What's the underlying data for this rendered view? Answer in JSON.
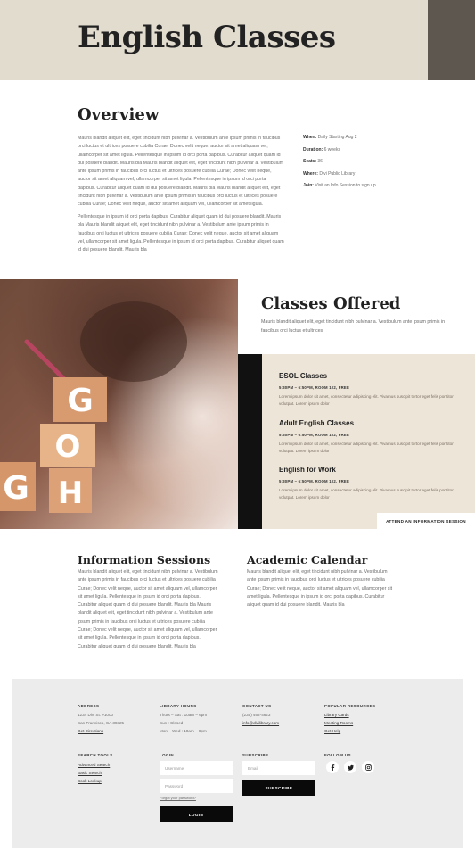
{
  "hero": {
    "title": "English Classes"
  },
  "overview": {
    "title": "Overview",
    "p1": "Mauris blandit aliquet elit, eget tincidunt nibh pulvinar a. Vestibulum ante ipsum primis in faucibus orci luctus et ultrices posuere cubilia Curae; Donec velit neque, auctor sit amet aliquam vel, ullamcorper sit amet ligula. Pellentesque in ipsum id orci porta dapibus. Curabitur aliquet quam id dui posuere blandit. Mauris bla Mauris blandit aliquet elit, eget tincidunt nibh pulvinar a. Vestibulum ante ipsum primis in faucibus orci luctus et ultrices posuere cubilia Curae; Donec velit neque, auctor sit amet aliquam vel, ullamcorper sit amet ligula. Pellentesque in ipsum id orci porta dapibus. Curabitur aliquet quam id dui posuere blandit. Mauris bla Mauris blandit aliquet elit, eget tincidunt nibh pulvinar a. Vestibulum ante ipsum primis in faucibus orci luctus et ultrices posuere cubilia Curae; Donec velit neque, auctor sit amet aliquam vel, ullamcorper sit amet ligula.",
    "p2": "Pellentesque in ipsum id orci porta dapibus. Curabitur aliquet quam id dui posuere blandit. Mauris bla Mauris blandit aliquet elit, eget tincidunt nibh pulvinar a. Vestibulum ante ipsum primis in faucibus orci luctus et ultrices posuere cubilia Curae; Donec velit neque, auctor sit amet aliquam vel, ullamcorper sit amet ligula. Pellentesque in ipsum id orci porta dapibus. Curabitur aliquet quam id dui posuere blandit. Mauris bla",
    "details": [
      {
        "label": "When:",
        "value": "Daily Starting Aug 2"
      },
      {
        "label": "Duration:",
        "value": "6 weeks"
      },
      {
        "label": "Seats:",
        "value": "36"
      },
      {
        "label": "Where:",
        "value": "Divi Public Library"
      },
      {
        "label": "Join:",
        "value": "Visit an Info Session to sign up"
      }
    ]
  },
  "classes": {
    "title": "Classes Offered",
    "intro": "Mauris blandit aliquet elit, eget tincidunt nibh pulvinar a. Vestibulum ante ipsum primis in faucibus orci luctus et ultrices",
    "items": [
      {
        "name": "ESOL Classes",
        "time": "5:30PM – 6:50PM, ROOM 102, FREE",
        "desc": "Lorem ipsum dolor sit amet, consectetur adipiscing elit. Vivamus suscipit tortor eget felis porttitor volutpat. Lorem ipsum dolor"
      },
      {
        "name": "Adult English Classes",
        "time": "5:30PM – 6:50PM, ROOM 102, FREE",
        "desc": "Lorem ipsum dolor sit amet, consectetur adipiscing elit. Vivamus suscipit tortor eget felis porttitor volutpat. Lorem ipsum dolor"
      },
      {
        "name": "English for Work",
        "time": "5:30PM – 6:50PM, ROOM 102, FREE",
        "desc": "Lorem ipsum dolor sit amet, consectetur adipiscing elit. Vivamus suscipit tortor eget felis porttitor volutpat. Lorem ipsum dolor"
      }
    ],
    "button": "ATTEND AN INFORMATION SESSION"
  },
  "photo": {
    "blocks": [
      "G",
      "O",
      "G",
      "H"
    ]
  },
  "info": {
    "title": "Information Sessions",
    "text": "Mauris blandit aliquet elit, eget tincidunt nibh pulvinar a. Vestibulum ante ipsum primis in faucibus orci luctus et ultrices posuere cubilia Curae; Donec velit neque, auctor sit amet aliquam vel, ullamcorper sit amet ligula. Pellentesque in ipsum id orci porta dapibus. Curabitur aliquet quam id dui posuere blandit. Mauris bla Mauris blandit aliquet elit, eget tincidunt nibh pulvinar a. Vestibulum ante ipsum primis in faucibus orci luctus et ultrices posuere cubilia Curae; Donec velit neque, auctor sit amet aliquam vel, ullamcorper sit amet ligula. Pellentesque in ipsum id orci porta dapibus. Curabitur aliquet quam id dui posuere blandit. Mauris bla"
  },
  "calendar": {
    "title": "Academic Calendar",
    "text": "Mauris blandit aliquet elit, eget tincidunt nibh pulvinar a. Vestibulum ante ipsum primis in faucibus orci luctus et ultrices posuere cubilia Curae; Donec velit neque, auctor sit amet aliquam vel, ullamcorper sit amet ligula. Pellentesque in ipsum id orci porta dapibus. Curabitur aliquet quam id dui posuere blandit. Mauris bla"
  },
  "footer": {
    "address": {
      "heading": "ADDRESS",
      "line1": "1234 Divi St. #1000",
      "line2": "San Francisco, CA 39325",
      "link": "Get Directions"
    },
    "hours": {
      "heading": "LIBRARY HOURS",
      "line1": "Thurs – Sat : 10am – 6pm",
      "line2": "Sun : Closed",
      "line3": "Mon – Wed : 10am – 8pm"
    },
    "contact": {
      "heading": "CONTACT US",
      "phone": "(235) 462-4623",
      "email": "info@divilibrary.com"
    },
    "resources": {
      "heading": "POPULAR RESOURCES",
      "links": [
        "Library Cards",
        "Meeting Rooms",
        "Get Help"
      ]
    },
    "search": {
      "heading": "SEARCH TOOLS",
      "links": [
        "Advanced Search",
        "Basic Search",
        "Book Lookup"
      ]
    },
    "login": {
      "heading": "LOGIN",
      "username_placeholder": "Username",
      "password_placeholder": "Password",
      "forgot": "Forgot your password?",
      "button": "LOGIN"
    },
    "subscribe": {
      "heading": "SUBSCRIBE",
      "email_placeholder": "Email",
      "button": "SUBSCRIBE"
    },
    "follow": {
      "heading": "FOLLOW US",
      "icons": [
        "facebook-icon",
        "twitter-icon",
        "instagram-icon"
      ]
    }
  }
}
